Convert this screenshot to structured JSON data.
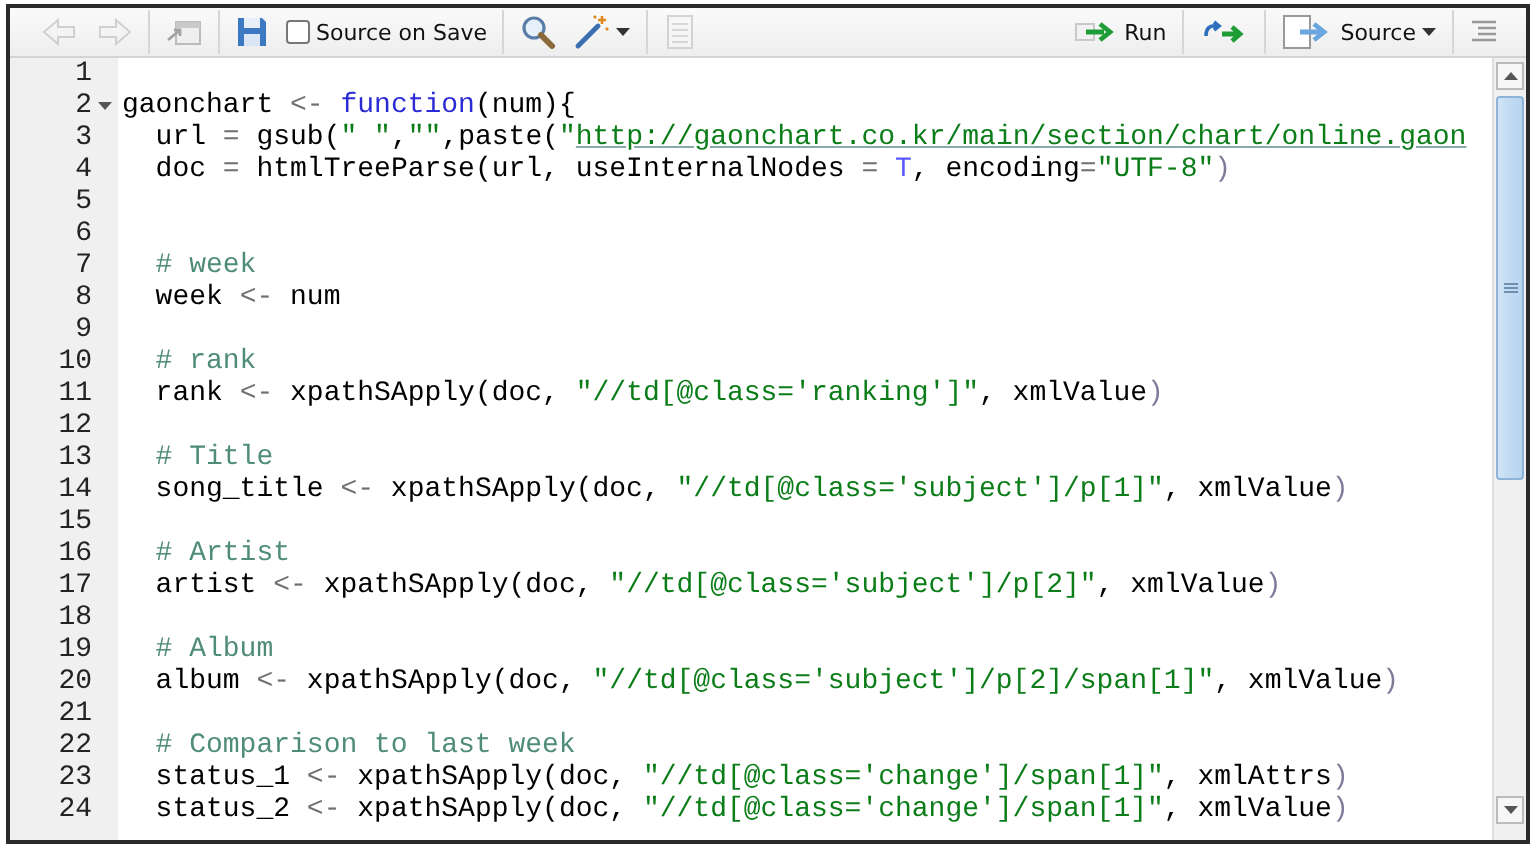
{
  "toolbar": {
    "left": [
      {
        "items": [
          {
            "kind": "back",
            "disabled": true
          },
          {
            "kind": "forward",
            "disabled": true
          }
        ]
      },
      {
        "items": [
          {
            "kind": "new_window",
            "disabled": true
          }
        ]
      },
      {
        "items": [
          {
            "kind": "save",
            "disabled": false
          },
          {
            "kind": "checkbox",
            "label": "Source on Save",
            "checked": false
          }
        ]
      },
      {
        "items": [
          {
            "kind": "find",
            "disabled": false
          },
          {
            "kind": "wand",
            "disabled": false,
            "dropdown": true
          }
        ]
      },
      {
        "items": [
          {
            "kind": "report",
            "disabled": true
          }
        ]
      }
    ],
    "right": [
      {
        "items": [
          {
            "kind": "run",
            "label": "Run",
            "disabled": false
          }
        ]
      },
      {
        "items": [
          {
            "kind": "rerun",
            "disabled": false
          }
        ]
      },
      {
        "items": [
          {
            "kind": "source",
            "label": "Source",
            "disabled": false,
            "dropdown": true
          }
        ]
      },
      {
        "items": [
          {
            "kind": "outline",
            "disabled": false
          }
        ]
      }
    ]
  },
  "lines": [
    {
      "number": "1",
      "fold": false
    },
    {
      "number": "2",
      "fold": true,
      "tokens": [
        {
          "kind": "plain",
          "text": "gaonchart "
        },
        {
          "kind": "operator",
          "text": "<- "
        },
        {
          "kind": "keyword",
          "text": "function"
        },
        {
          "kind": "plain",
          "text": "(num){"
        }
      ]
    },
    {
      "number": "3",
      "fold": false,
      "tokens": [
        {
          "kind": "plain",
          "text": "  url "
        },
        {
          "kind": "operator",
          "text": "="
        },
        {
          "kind": "plain",
          "text": " gsub("
        },
        {
          "kind": "string",
          "text": "\" \""
        },
        {
          "kind": "plain",
          "text": ","
        },
        {
          "kind": "string",
          "text": "\"\""
        },
        {
          "kind": "plain",
          "text": ",paste("
        },
        {
          "kind": "string",
          "text": "\""
        },
        {
          "kind": "url",
          "text": "http://gaonchart.co.kr/main/section/chart/online.gaon"
        }
      ]
    },
    {
      "number": "4",
      "fold": false,
      "tokens": [
        {
          "kind": "plain",
          "text": "  doc "
        },
        {
          "kind": "operator",
          "text": "="
        },
        {
          "kind": "plain",
          "text": " htmlTreeParse(url, useInternalNodes "
        },
        {
          "kind": "operator",
          "text": "= "
        },
        {
          "kind": "constant",
          "text": "T"
        },
        {
          "kind": "plain",
          "text": ", encoding"
        },
        {
          "kind": "operator",
          "text": "="
        },
        {
          "kind": "string",
          "text": "\"UTF-8\""
        },
        {
          "kind": "paren",
          "text": ")"
        }
      ]
    },
    {
      "number": "5",
      "fold": false
    },
    {
      "number": "6",
      "fold": false
    },
    {
      "number": "7",
      "fold": false,
      "tokens": [
        {
          "kind": "comment",
          "text": "  # week"
        }
      ]
    },
    {
      "number": "8",
      "fold": false,
      "tokens": [
        {
          "kind": "plain",
          "text": "  week "
        },
        {
          "kind": "operator",
          "text": "<-"
        },
        {
          "kind": "plain",
          "text": " num"
        }
      ]
    },
    {
      "number": "9",
      "fold": false
    },
    {
      "number": "10",
      "fold": false,
      "tokens": [
        {
          "kind": "comment",
          "text": "  # rank"
        }
      ]
    },
    {
      "number": "11",
      "fold": false,
      "tokens": [
        {
          "kind": "plain",
          "text": "  rank "
        },
        {
          "kind": "operator",
          "text": "<-"
        },
        {
          "kind": "plain",
          "text": " xpathSApply(doc, "
        },
        {
          "kind": "string",
          "text": "\"//td[@class='ranking']\""
        },
        {
          "kind": "plain",
          "text": ", xmlValue"
        },
        {
          "kind": "paren",
          "text": ")"
        }
      ]
    },
    {
      "number": "12",
      "fold": false
    },
    {
      "number": "13",
      "fold": false,
      "tokens": [
        {
          "kind": "comment",
          "text": "  # Title"
        }
      ]
    },
    {
      "number": "14",
      "fold": false,
      "tokens": [
        {
          "kind": "plain",
          "text": "  song_title "
        },
        {
          "kind": "operator",
          "text": "<-"
        },
        {
          "kind": "plain",
          "text": " xpathSApply(doc, "
        },
        {
          "kind": "string",
          "text": "\"//td[@class='subject']/p[1]\""
        },
        {
          "kind": "plain",
          "text": ", xmlValue"
        },
        {
          "kind": "paren",
          "text": ")"
        }
      ]
    },
    {
      "number": "15",
      "fold": false
    },
    {
      "number": "16",
      "fold": false,
      "tokens": [
        {
          "kind": "comment",
          "text": "  # Artist"
        }
      ]
    },
    {
      "number": "17",
      "fold": false,
      "tokens": [
        {
          "kind": "plain",
          "text": "  artist "
        },
        {
          "kind": "operator",
          "text": "<-"
        },
        {
          "kind": "plain",
          "text": " xpathSApply(doc, "
        },
        {
          "kind": "string",
          "text": "\"//td[@class='subject']/p[2]\""
        },
        {
          "kind": "plain",
          "text": ", xmlValue"
        },
        {
          "kind": "paren",
          "text": ")"
        }
      ]
    },
    {
      "number": "18",
      "fold": false
    },
    {
      "number": "19",
      "fold": false,
      "tokens": [
        {
          "kind": "comment",
          "text": "  # Album"
        }
      ]
    },
    {
      "number": "20",
      "fold": false,
      "tokens": [
        {
          "kind": "plain",
          "text": "  album "
        },
        {
          "kind": "operator",
          "text": "<-"
        },
        {
          "kind": "plain",
          "text": " xpathSApply(doc, "
        },
        {
          "kind": "string",
          "text": "\"//td[@class='subject']/p[2]/span[1]\""
        },
        {
          "kind": "plain",
          "text": ", xmlValue"
        },
        {
          "kind": "paren",
          "text": ")"
        }
      ]
    },
    {
      "number": "21",
      "fold": false
    },
    {
      "number": "22",
      "fold": false,
      "tokens": [
        {
          "kind": "comment",
          "text": "  # Comparison to last week"
        }
      ]
    },
    {
      "number": "23",
      "fold": false,
      "tokens": [
        {
          "kind": "plain",
          "text": "  status_1 "
        },
        {
          "kind": "operator",
          "text": "<-"
        },
        {
          "kind": "plain",
          "text": " xpathSApply(doc, "
        },
        {
          "kind": "string",
          "text": "\"//td[@class='change']/span[1]\""
        },
        {
          "kind": "plain",
          "text": ", xmlAttrs"
        },
        {
          "kind": "paren",
          "text": ")"
        }
      ]
    },
    {
      "number": "24",
      "fold": false,
      "tokens": [
        {
          "kind": "plain",
          "text": "  status_2 "
        },
        {
          "kind": "operator",
          "text": "<-"
        },
        {
          "kind": "plain",
          "text": " xpathSApply(doc, "
        },
        {
          "kind": "string",
          "text": "\"//td[@class='change']/span[1]\""
        },
        {
          "kind": "plain",
          "text": ", xmlValue"
        },
        {
          "kind": "paren",
          "text": ")"
        }
      ]
    }
  ]
}
